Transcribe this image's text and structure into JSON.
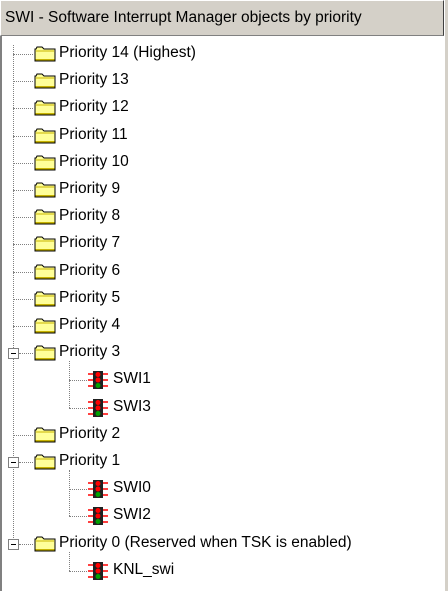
{
  "header": {
    "title": "SWI - Software Interrupt Manager objects by priority"
  },
  "colors": {
    "folder_fill": "#ffff99",
    "folder_dark": "#c8b400",
    "icon_red": "#ff0000",
    "icon_green": "#00a000",
    "header_bg": "#d4d0c8"
  },
  "tree": {
    "nodes": [
      {
        "label": "Priority 14 (Highest)",
        "icon": "folder-icon",
        "level": 0,
        "expanded": false
      },
      {
        "label": "Priority 13",
        "icon": "folder-icon",
        "level": 0,
        "expanded": false
      },
      {
        "label": "Priority 12",
        "icon": "folder-icon",
        "level": 0,
        "expanded": false
      },
      {
        "label": "Priority 11",
        "icon": "folder-icon",
        "level": 0,
        "expanded": false
      },
      {
        "label": "Priority 10",
        "icon": "folder-icon",
        "level": 0,
        "expanded": false
      },
      {
        "label": "Priority 9",
        "icon": "folder-icon",
        "level": 0,
        "expanded": false
      },
      {
        "label": "Priority 8",
        "icon": "folder-icon",
        "level": 0,
        "expanded": false
      },
      {
        "label": "Priority 7",
        "icon": "folder-icon",
        "level": 0,
        "expanded": false
      },
      {
        "label": "Priority 6",
        "icon": "folder-icon",
        "level": 0,
        "expanded": false
      },
      {
        "label": "Priority 5",
        "icon": "folder-icon",
        "level": 0,
        "expanded": false
      },
      {
        "label": "Priority 4",
        "icon": "folder-icon",
        "level": 0,
        "expanded": false
      },
      {
        "label": "Priority 3",
        "icon": "folder-icon",
        "level": 0,
        "expanded": true
      },
      {
        "label": "SWI1",
        "icon": "swi-object-icon",
        "level": 1
      },
      {
        "label": "SWI3",
        "icon": "swi-object-icon",
        "level": 1
      },
      {
        "label": "Priority 2",
        "icon": "folder-icon",
        "level": 0,
        "expanded": false
      },
      {
        "label": "Priority 1",
        "icon": "folder-icon",
        "level": 0,
        "expanded": true
      },
      {
        "label": "SWI0",
        "icon": "swi-object-icon",
        "level": 1
      },
      {
        "label": "SWI2",
        "icon": "swi-object-icon",
        "level": 1
      },
      {
        "label": "Priority 0 (Reserved when TSK is enabled)",
        "icon": "folder-icon",
        "level": 0,
        "expanded": true
      },
      {
        "label": "KNL_swi",
        "icon": "swi-object-icon",
        "level": 1
      }
    ]
  }
}
